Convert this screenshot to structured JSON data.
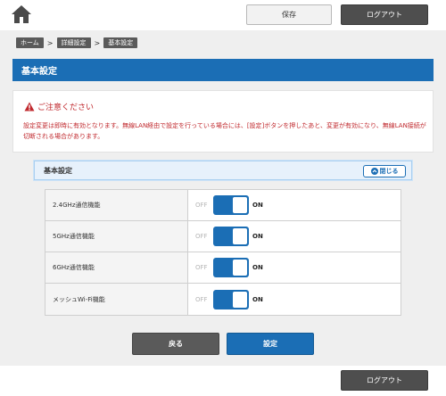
{
  "header": {
    "save_label": "保存",
    "logout_label": "ログアウト"
  },
  "breadcrumb": [
    "ホーム",
    "詳細設定",
    "基本設定"
  ],
  "page_title": "基本設定",
  "notice": {
    "title": "ご注意ください",
    "text": "設定変更は即時に有効となります。無線LAN経由で設定を行っている場合には、[設定]ボタンを押したあと、変更が有効になり、無線LAN接続が切断される場合があります。"
  },
  "section": {
    "title": "基本設定",
    "close_label": "閉じる"
  },
  "toggle_labels": {
    "off": "OFF",
    "on": "ON"
  },
  "settings": [
    {
      "label": "2.4GHz通信機能",
      "state": "ON"
    },
    {
      "label": "5GHz通信機能",
      "state": "ON"
    },
    {
      "label": "6GHz通信機能",
      "state": "ON"
    },
    {
      "label": "メッシュWi-Fi機能",
      "state": "ON"
    }
  ],
  "actions": {
    "back_label": "戻る",
    "apply_label": "設定"
  },
  "footer": {
    "logout_label": "ログアウト"
  },
  "colors": {
    "accent": "#1b6eb5",
    "warning": "#c0282d",
    "dark_button": "#4e4e4e",
    "background": "#efefef"
  },
  "icons": [
    "home-icon",
    "warning-icon",
    "chevron-up-icon"
  ]
}
